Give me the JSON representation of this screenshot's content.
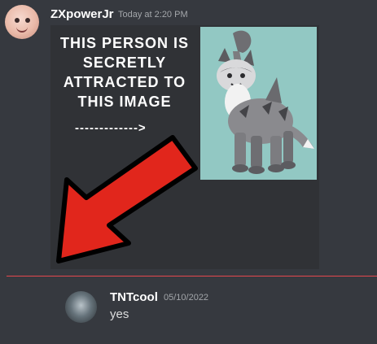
{
  "messages": [
    {
      "username": "ZXpowerJr",
      "timestamp": "Today at 2:20 PM",
      "attachment": {
        "text_lines": [
          "THIS PERSON IS",
          "SECRETLY",
          "ATTRACTED TO",
          "THIS IMAGE"
        ],
        "pointer_text": "------------->"
      }
    },
    {
      "username": "TNTcool",
      "timestamp": "05/10/2022",
      "content": "yes"
    }
  ],
  "colors": {
    "background": "#36393f",
    "username": "#ffffff",
    "timestamp": "#a3a6aa",
    "message_text": "#dcddde",
    "new_messages_divider": "#e5484d",
    "arrow_red": "#e1261c"
  }
}
